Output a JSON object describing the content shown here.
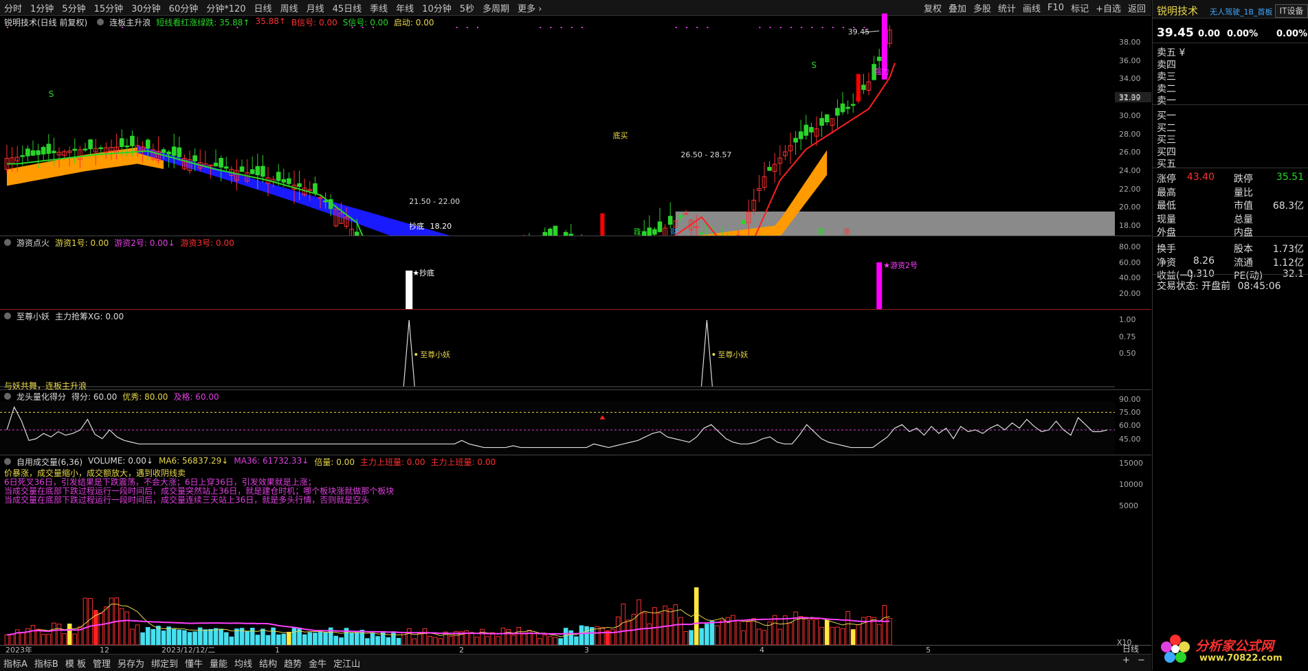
{
  "toolbar": {
    "periods": [
      "分时",
      "1分钟",
      "5分钟",
      "15分钟",
      "30分钟",
      "60分钟",
      "分钟*120",
      "日线",
      "周线",
      "月线",
      "45日线",
      "季线",
      "年线",
      "10分钟",
      "5秒",
      "多周期",
      "更多 ›"
    ],
    "active_period": "日线",
    "right": [
      "复权",
      "叠加",
      "多股",
      "统计",
      "画线",
      "F10",
      "标记",
      "+自选",
      "返回"
    ]
  },
  "main_panel": {
    "title": "锐明技术(日线 前复权)",
    "indicator": "连板主升浪",
    "legend": [
      {
        "label": "短线看红涨绿跌: 35.88↑",
        "color": "#2ad52a"
      },
      {
        "label": "35.88↑",
        "color": "#ff3030"
      },
      {
        "label": "B信号: 0.00",
        "color": "#ff3030"
      },
      {
        "label": "S信号: 0.00",
        "color": "#2ad52a"
      },
      {
        "label": "启动: 0.00",
        "color": "#e8d84a"
      }
    ],
    "annotations": {
      "high_price": "39.45",
      "low_label": "抄底",
      "low_value": "18.20",
      "range1": "21.50 - 22.00",
      "range2": "26.50 - 28.57",
      "current_tag": "31.39",
      "power_label": "强力",
      "buy_label": "底买",
      "s_label": "S",
      "markers": [
        {
          "t": "跌",
          "c": "#2ad52a"
        },
        {
          "t": "财",
          "c": "#3da8ff"
        },
        {
          "t": "港",
          "c": "#2ad52a"
        },
        {
          "t": "涨",
          "c": "#ff3030"
        }
      ]
    },
    "yaxis": [
      "38.00",
      "36.00",
      "34.00",
      "32.00",
      "30.00",
      "28.00",
      "26.00",
      "24.00",
      "22.00",
      "20.00",
      "18.00"
    ]
  },
  "panel2": {
    "title": "游资点火",
    "legend": [
      {
        "label": "游资1号: 0.00",
        "color": "#e8d84a"
      },
      {
        "label": "游资2号: 0.00↓",
        "color": "#e040e0"
      },
      {
        "label": "游资3号: 0.00",
        "color": "#ff3030"
      }
    ],
    "bar_label1": "★抄底",
    "bar_label2": "★游资2号",
    "yaxis": [
      "80.00",
      "60.00",
      "40.00",
      "20.00"
    ]
  },
  "panel3": {
    "title": "至尊小妖",
    "legend": [
      {
        "label": "主力抢筹XG: 0.00",
        "color": "#dddddd"
      }
    ],
    "peak_label": "至尊小妖",
    "footer": "与妖共舞，连板主升浪",
    "yaxis": [
      "1.00",
      "0.75",
      "0.50"
    ]
  },
  "panel4": {
    "title": "龙头量化得分",
    "legend": [
      {
        "label": "得分: 60.00",
        "color": "#dddddd"
      },
      {
        "label": "优秀: 80.00",
        "color": "#e8d84a"
      },
      {
        "label": "及格: 60.00",
        "color": "#e040e0"
      }
    ],
    "yaxis": [
      "90.00",
      "75.00",
      "60.00",
      "45.00"
    ]
  },
  "panel5": {
    "title": "自用成交量(6,36)",
    "legend": [
      {
        "label": "VOLUME: 0.00↓",
        "color": "#dddddd"
      },
      {
        "label": "MA6: 56837.29↓",
        "color": "#e8d84a"
      },
      {
        "label": "MA36: 61732.33↓",
        "color": "#e040e0"
      },
      {
        "label": "倍量: 0.00",
        "color": "#e8d84a"
      },
      {
        "label": "主力上班量: 0.00",
        "color": "#ff3030"
      },
      {
        "label": "主力上班量: 0.00",
        "color": "#ff3030"
      }
    ],
    "notes": [
      {
        "t": "价暴涨，成交量缩小，成交额放大，遇到收阴线卖",
        "c": "#e8d84a"
      },
      {
        "t": "6日死叉36日，引发结果是下跌震荡，不会大涨；6日上穿36日，引发效果就是上涨；",
        "c": "#e040e0"
      },
      {
        "t": "当成交量在底部下跌过程运行一段时间后，成交量突然站上36日，就是建仓时机；哪个板块涨就做那个板块",
        "c": "#e040e0"
      },
      {
        "t": "当成交量在底部下跌过程运行一段时间后，成交量连续三天站上36日，就是多头行情，否则就是空头",
        "c": "#e040e0"
      }
    ],
    "yaxis": [
      "15000",
      "10000",
      "5000"
    ],
    "xaxis": [
      "2023年",
      "12",
      "2023/12/12/二",
      "1",
      "2",
      "3",
      "4",
      "5"
    ],
    "x10": "X10"
  },
  "right_panel": {
    "name": "锐明技术",
    "tag": "无人驾驶_1B_首板",
    "it": "IT设备",
    "price": "39.45",
    "change": "0.00",
    "pct": "0.00%",
    "pct2": "0.00%",
    "sell": [
      "卖五 ¥",
      "卖四",
      "卖三",
      "卖二",
      "卖一"
    ],
    "buy": [
      "买一",
      "买二",
      "买三",
      "买四",
      "买五"
    ],
    "stats": [
      {
        "l": "涨停",
        "v": "43.40",
        "vc": "#ff3030",
        "r": "跌停",
        "rv": "35.51",
        "rvc": "#2ad52a"
      },
      {
        "l": "最高",
        "v": "",
        "vc": "#ddd",
        "r": "量比",
        "rv": "",
        "rvc": "#ddd"
      },
      {
        "l": "最低",
        "v": "",
        "vc": "#ddd",
        "r": "市值",
        "rv": "68.3亿",
        "rvc": "#ddd"
      },
      {
        "l": "现量",
        "v": "",
        "vc": "#ddd",
        "r": "总量",
        "rv": "",
        "rvc": "#ddd"
      },
      {
        "l": "外盘",
        "v": "",
        "vc": "#ddd",
        "r": "内盘",
        "rv": "",
        "rvc": "#ddd"
      },
      {
        "l": "换手",
        "v": "",
        "vc": "#ddd",
        "r": "股本",
        "rv": "1.73亿",
        "rvc": "#ddd"
      },
      {
        "l": "净资",
        "v": "8.26",
        "vc": "#ddd",
        "r": "流通",
        "rv": "1.12亿",
        "rvc": "#ddd"
      },
      {
        "l": "收益(一)",
        "v": "0.310",
        "vc": "#ddd",
        "r": "PE(动)",
        "rv": "32.1",
        "rvc": "#ddd"
      }
    ],
    "trade_status": "交易状态: 开盘前",
    "trade_time": "08:45:06",
    "bottom_label": "日线",
    "bottom_icons": [
      "+",
      "−"
    ],
    "logo_text": "分析家公式网",
    "logo_url": "www.70822.com"
  },
  "bottombar": [
    "指标A",
    "指标B",
    "模 板",
    "管理",
    "另存为",
    "绑定到",
    "懂牛",
    "量能",
    "均线",
    "结构",
    "趋势",
    "金牛",
    "定江山"
  ],
  "bottom_active": "管理"
}
